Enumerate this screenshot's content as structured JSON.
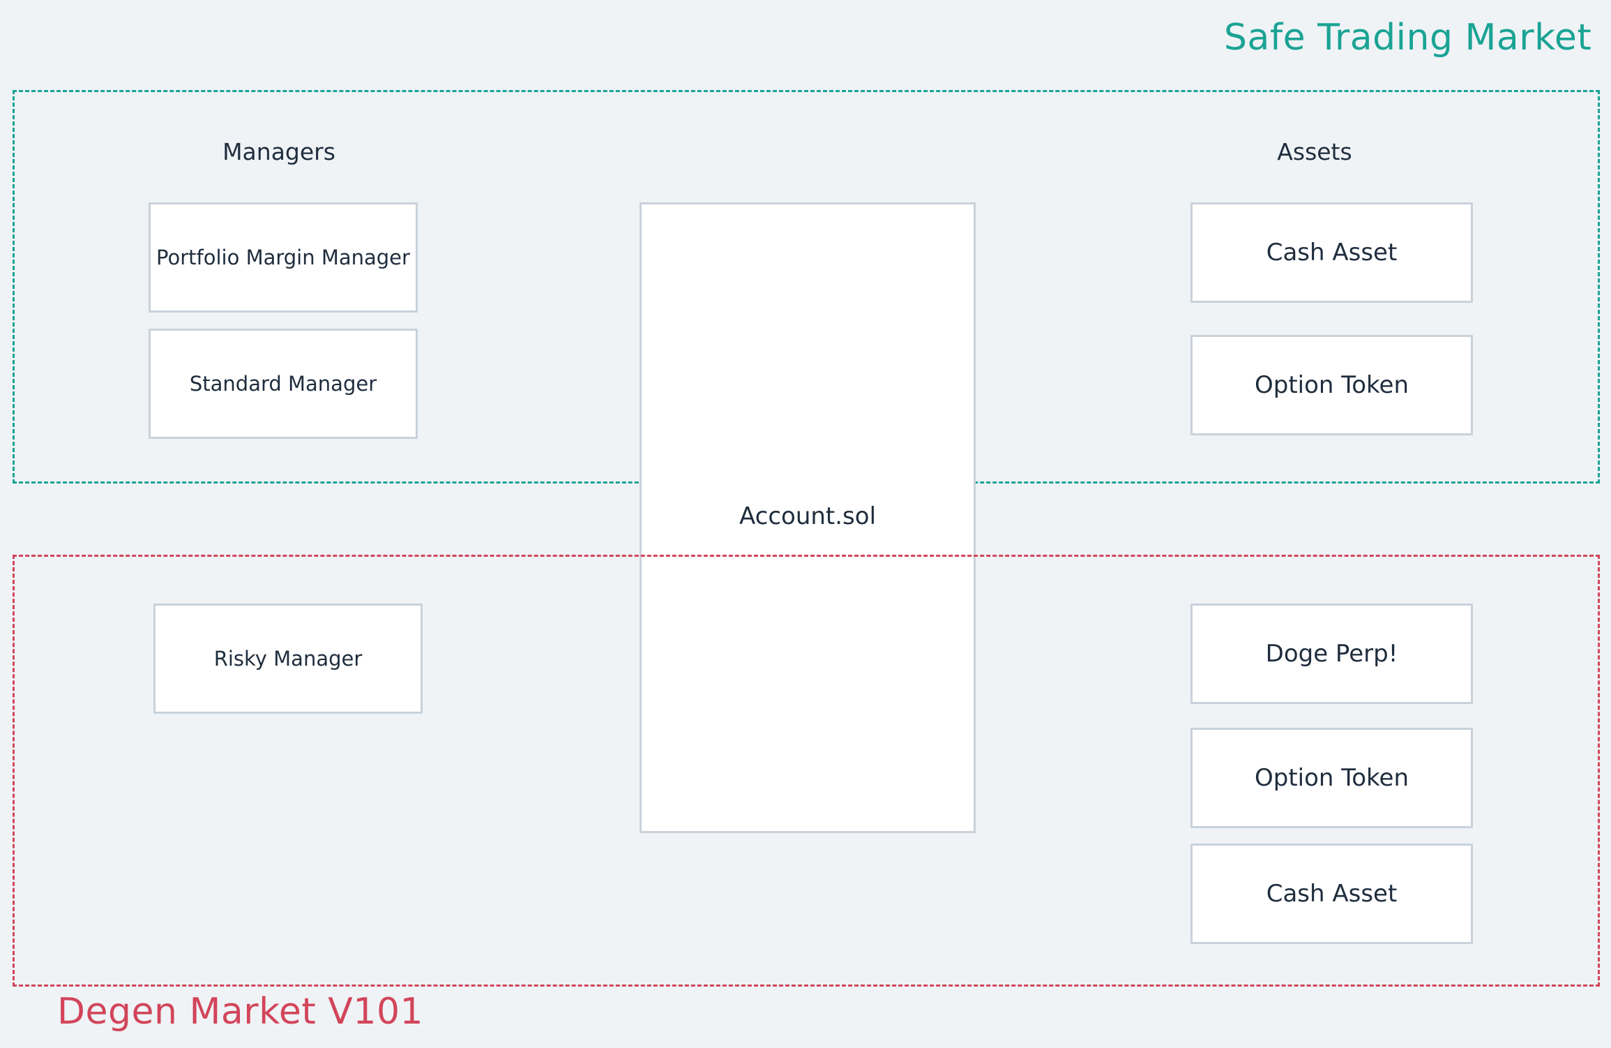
{
  "colors": {
    "safe_accent": "#1aa394",
    "degen_accent": "#d2455a",
    "text": "#1f2d3d"
  },
  "safe_market": {
    "title": "Safe Trading Market",
    "managers_heading": "Managers",
    "assets_heading": "Assets",
    "managers": [
      "Portfolio Margin Manager",
      "Standard Manager"
    ],
    "assets": [
      "Cash Asset",
      "Option Token"
    ]
  },
  "account": {
    "label": "Account.sol"
  },
  "degen_market": {
    "title": "Degen Market V101",
    "managers": [
      "Risky Manager"
    ],
    "assets": [
      "Doge Perp!",
      "Option Token",
      "Cash Asset"
    ]
  }
}
